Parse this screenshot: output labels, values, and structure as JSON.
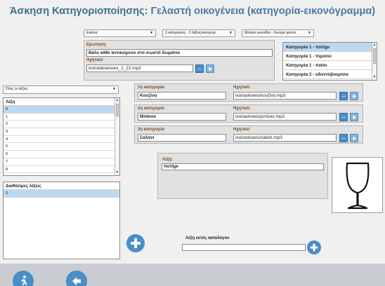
{
  "title": {
    "prefix": "Άσκηση Κατηγοριοποίησης:",
    "name": "Γελαστή οικογένεια (κατηγορία-εικονόγραμμα)"
  },
  "toolbar": {
    "type_select": "Εικόνα",
    "categories_select": "3 κατηγορίες - 3 λέξεις/κατηγορ",
    "background_select": "Ματίρο εικονίδιο - Λευτρο φόντο"
  },
  "question": {
    "label": "Ερώτηση:",
    "text": "Βάλε κάθε αντικείμενο στο σωστό δωμάτιο",
    "audio_label": "Ηχητικό:",
    "audio_value": "ixoi/askiseis/ex_1_22.mp3"
  },
  "category_words": [
    "Κατηγορία 1 - ποτήρι",
    "Κατηγορία 1 - πιρούνι",
    "Κατηγορία 1 - πιάτο",
    "Κατηγορία 2 - οδοντόβουρτσα"
  ],
  "word_filter": "Όλες οι λέξεις",
  "words_list": {
    "header": "Λέξη",
    "rows": [
      "0",
      "1",
      "2",
      "3",
      "4",
      "5",
      "6",
      "7",
      "8"
    ]
  },
  "available_words": {
    "header": "Διαθέσιμες λέξεις",
    "rows": [
      "0"
    ]
  },
  "categories": [
    {
      "label": "1η κατηγορία",
      "name": "Κουζίνα",
      "audio_label": "Ηχητικό:",
      "audio": "ixoi/askiseis/κουζίνα.mp3"
    },
    {
      "label": "2η κατηγορία",
      "name": "Μπάνιο",
      "audio_label": "Ηχητικό:",
      "audio": "ixoi/askiseis/μπάνιο.mp3"
    },
    {
      "label": "3η κατηγορία",
      "name": "Σαλόνι",
      "audio_label": "Ηχητικό:",
      "audio": "ixoi/askiseis/saloni.mp3"
    }
  ],
  "word_detail": {
    "label": "Λέξη:",
    "value": "ποτήρι"
  },
  "outside_catalog": {
    "label": "Λέξη εκτός καταλόγου",
    "value": ""
  },
  "colors": {
    "accent": "#4a8ec8",
    "title": "#3d6f8c",
    "label": "#7a4b1e",
    "footer": "#c9ccd0"
  },
  "icons": {
    "browse": "ellipsis-icon",
    "play": "play-icon",
    "add": "plus-icon",
    "image": "wine-glass-icon",
    "exit": "running-man-icon",
    "back": "back-arrow-icon"
  }
}
